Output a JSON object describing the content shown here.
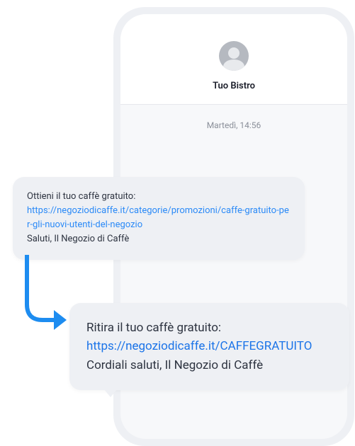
{
  "phone": {
    "sender": "Tuo Bistro",
    "timestamp": "Martedì, 14:56"
  },
  "message_before": {
    "intro": "Ottieni il tuo caffè gratuito:",
    "link": "https://negoziodicaffe.it/categorie/promozioni/caffe-gratuito-per-gli-nuovi-utenti-del-negozio",
    "signoff": "Saluti, Il Negozio di Caffè"
  },
  "message_after": {
    "intro": "Ritira il tuo caffè gratuito:",
    "link": "https://negoziodicaffe.it/CAFFEGRATUITO",
    "signoff": "Cordiali saluti, Il Negozio di Caffè"
  }
}
